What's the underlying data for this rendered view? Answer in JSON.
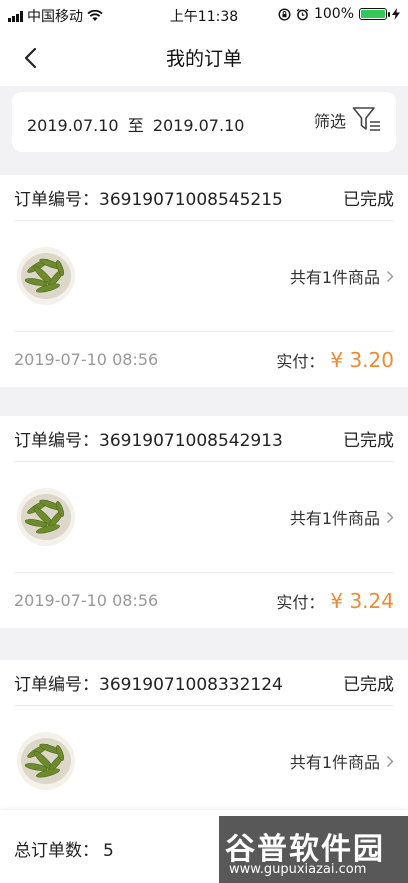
{
  "status": {
    "carrier": "中国移动",
    "time": "上午11:38",
    "battery_text": "100%",
    "battery_level": 1.0,
    "icons": [
      "signal-icon",
      "wifi-icon",
      "rotation-lock-icon",
      "alarm-icon",
      "battery-icon",
      "charging-icon"
    ]
  },
  "nav": {
    "title": "我的订单",
    "back_icon": "back-chevron-icon"
  },
  "date_filter": {
    "start": "2019.07.10",
    "separator": "至",
    "end": "2019.07.10",
    "filter_label": "筛选",
    "filter_icon": "funnel-list-icon"
  },
  "labels": {
    "order_no": "订单编号：",
    "paid": "实付：",
    "item_count": "共有1件商品",
    "status_done": "已完成"
  },
  "orders": [
    {
      "number": "36919071008545215",
      "status": "已完成",
      "items": "共有1件商品",
      "time": "2019-07-10 08:56",
      "amount": "¥ 3.20"
    },
    {
      "number": "36919071008542913",
      "status": "已完成",
      "items": "共有1件商品",
      "time": "2019-07-10 08:56",
      "amount": "¥ 3.24"
    },
    {
      "number": "36919071008332124",
      "status": "已完成",
      "items": "共有1件商品",
      "time": "",
      "amount": ""
    }
  ],
  "footer": {
    "total_label": "总订单数：",
    "total": "5"
  },
  "watermark": {
    "logo": "谷普软件园",
    "url": "www.gupuxiazai.com"
  },
  "colors": {
    "accent": "#ee8a34",
    "background": "#f2f2f4",
    "card": "#ffffff"
  }
}
